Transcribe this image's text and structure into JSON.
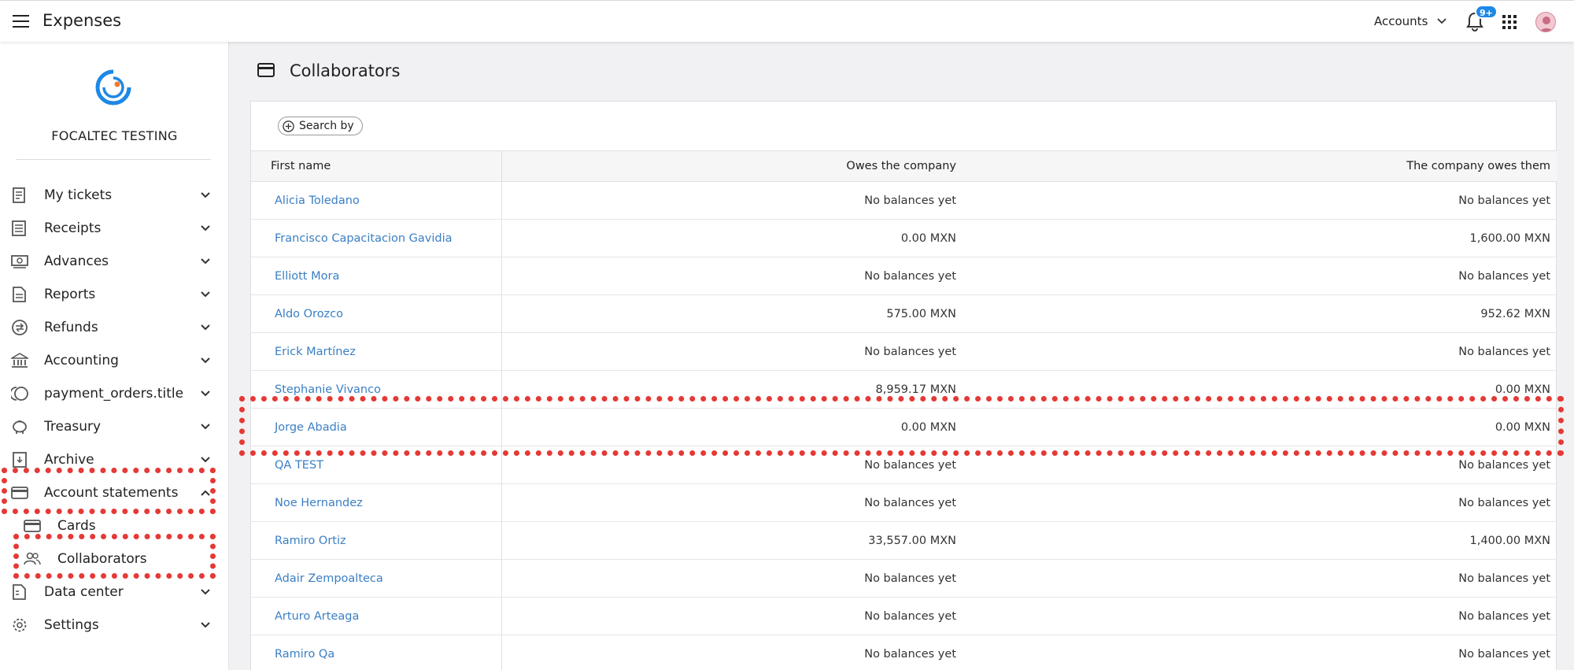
{
  "app": {
    "title": "Expenses"
  },
  "topbar": {
    "accounts_label": "Accounts",
    "notifications_badge": "9+"
  },
  "sidebar": {
    "company": "FOCALTEC TESTING",
    "items": [
      {
        "label": "My tickets",
        "icon": "ticket-icon",
        "expanded": false
      },
      {
        "label": "Receipts",
        "icon": "receipt-icon",
        "expanded": false
      },
      {
        "label": "Advances",
        "icon": "cash-icon",
        "expanded": false
      },
      {
        "label": "Reports",
        "icon": "report-icon",
        "expanded": false
      },
      {
        "label": "Refunds",
        "icon": "refund-icon",
        "expanded": false
      },
      {
        "label": "Accounting",
        "icon": "bank-icon",
        "expanded": false
      },
      {
        "label": "payment_orders.title",
        "icon": "coins-icon",
        "expanded": false
      },
      {
        "label": "Treasury",
        "icon": "piggy-bank-icon",
        "expanded": false
      },
      {
        "label": "Archive",
        "icon": "archive-icon",
        "expanded": false
      },
      {
        "label": "Account statements",
        "icon": "card-icon",
        "expanded": true
      },
      {
        "label": "Data center",
        "icon": "data-center-icon",
        "expanded": false
      },
      {
        "label": "Settings",
        "icon": "gear-icon",
        "expanded": false
      }
    ],
    "subitems": [
      {
        "label": "Cards",
        "icon": "card-icon"
      },
      {
        "label": "Collaborators",
        "icon": "users-icon"
      }
    ]
  },
  "page": {
    "title": "Collaborators",
    "search_label": "Search by"
  },
  "table": {
    "columns": [
      "First name",
      "Owes the company",
      "The company owes them"
    ],
    "rows": [
      {
        "name": "Alicia Toledano",
        "owes": "No balances yet",
        "owed": "No balances yet"
      },
      {
        "name": "Francisco Capacitacion Gavidia",
        "owes": "0.00 MXN",
        "owed": "1,600.00 MXN"
      },
      {
        "name": "Elliott Mora",
        "owes": "No balances yet",
        "owed": "No balances yet"
      },
      {
        "name": "Aldo Orozco",
        "owes": "575.00 MXN",
        "owed": "952.62 MXN"
      },
      {
        "name": "Erick Martínez",
        "owes": "No balances yet",
        "owed": "No balances yet"
      },
      {
        "name": "Stephanie Vivanco",
        "owes": "8,959.17 MXN",
        "owed": "0.00 MXN"
      },
      {
        "name": "Jorge Abadia",
        "owes": "0.00 MXN",
        "owed": "0.00 MXN"
      },
      {
        "name": "QA TEST",
        "owes": "No balances yet",
        "owed": "No balances yet"
      },
      {
        "name": "Noe Hernandez",
        "owes": "No balances yet",
        "owed": "No balances yet"
      },
      {
        "name": "Ramiro Ortiz",
        "owes": "33,557.00 MXN",
        "owed": "1,400.00 MXN"
      },
      {
        "name": "Adair Zempoalteca",
        "owes": "No balances yet",
        "owed": "No balances yet"
      },
      {
        "name": "Arturo Arteaga",
        "owes": "No balances yet",
        "owed": "No balances yet"
      },
      {
        "name": "Ramiro Qa",
        "owes": "No balances yet",
        "owed": "No balances yet"
      }
    ]
  },
  "colors": {
    "link": "#3a7fc4",
    "badge": "#1e88e5",
    "highlight": "#e53935"
  }
}
